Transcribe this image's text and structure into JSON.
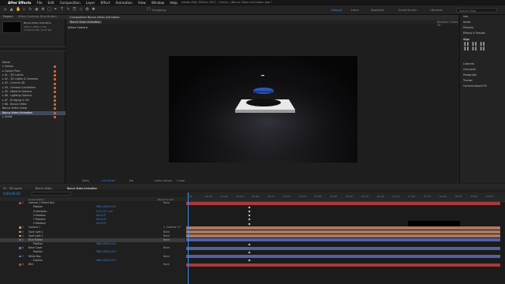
{
  "menubar": {
    "items": [
      "After Effects",
      "File",
      "Edit",
      "Composition",
      "Layer",
      "Effect",
      "Animation",
      "View",
      "Window",
      "Help"
    ],
    "title": "Adobe After Effects 2020 - /Users/.../Bonus Video Animation.aep *"
  },
  "toolbar": {
    "snapping": "Snapping",
    "workspaces": [
      "Default",
      "Learn",
      "Standard",
      "Small Screen",
      "Libraries"
    ],
    "search": "Search Help"
  },
  "project": {
    "tab": "Project",
    "effects_tab": "Effect Controls: Blue Button",
    "selected_name": "Bonus Video Animation",
    "selected_info": [
      "1920 x 1080 (1.00)",
      "Δ 0;00;10;00, 29.97 fps"
    ],
    "items": [
      {
        "label": "Name",
        "sel": false
      },
      {
        "label": "▾ Comps",
        "sel": false
      },
      {
        "label": "  ▸ Comps Prep",
        "sel": false
      },
      {
        "label": "  ▸ 01 - 3D Layers",
        "sel": false
      },
      {
        "label": "  ▸ 02 - 3D Lights & Cameras",
        "sel": false
      },
      {
        "label": "  ▸ 03 - Cinema 4D",
        "sel": false
      },
      {
        "label": "  ▸ 04 - Camera Controllers",
        "sel": false
      },
      {
        "label": "  ▸ 05 - Material Options",
        "sel": false
      },
      {
        "label": "  ▸ 06 - Lighting Options",
        "sel": false
      },
      {
        "label": "  ▸ 07 - Bridging in 3D",
        "sel": false
      },
      {
        "label": "  ▾ 08 - Bonus Video",
        "sel": false
      },
      {
        "label": "      Bonus Video Comp",
        "sel": false
      },
      {
        "label": "      Bonus Video Animation",
        "sel": true
      },
      {
        "label": "▸ Solids",
        "sel": false
      }
    ]
  },
  "viewer": {
    "tab": "Composition Bonus Video Animation",
    "sub_tab": "Bonus Video Animation",
    "camera_label": "Active Camera",
    "renderer": "Renderer: Classic 3D",
    "footer": {
      "zoom": "(50%)",
      "time": "0;00;00;00",
      "resolution": "Full",
      "view": "Active Camera",
      "views": "1 View"
    }
  },
  "right_panel": {
    "items": [
      "Info",
      "Audio",
      "Preview",
      "Effects & Presets",
      "Align",
      "Libraries",
      "Character",
      "Paragraph",
      "Tracker",
      "Content-Aware Fill"
    ]
  },
  "timeline": {
    "tabs": [
      "01 - 3D Layers",
      "Bonus Video",
      "Bonus Video Animation"
    ],
    "time": "0;00;00;00",
    "header": {
      "source": "Source Name",
      "mode": "Parent & Link"
    },
    "ruler_ticks": [
      "0f",
      "00:15f",
      "01:00f",
      "01:15f",
      "02:00f",
      "02:15f",
      "03:00f",
      "03:15f",
      "04:00f",
      "04:15f",
      "05:00f",
      "05:15f",
      "06:00f",
      "06:15f",
      "07:00f",
      "07:15f",
      "08:00f",
      "08:15f",
      "09:00f",
      "09:15f"
    ],
    "layers": [
      {
        "num": "1",
        "name": "Camera 1 Parent Null",
        "value": "",
        "mode": "None",
        "color": "#c04040",
        "sel": false
      },
      {
        "num": "",
        "name": "Position",
        "value": "960.0,540.0,0.0",
        "mode": "",
        "color": "#1f1f1f",
        "sel": false
      },
      {
        "num": "",
        "name": "Orientation",
        "value": "0.0°,0.0°,0.0°",
        "mode": "",
        "color": "#1f1f1f",
        "sel": false
      },
      {
        "num": "",
        "name": "X Rotation",
        "value": "0x+0.0°",
        "mode": "",
        "color": "#1f1f1f",
        "sel": false
      },
      {
        "num": "",
        "name": "Y Rotation",
        "value": "0x+0.0°",
        "mode": "",
        "color": "#1f1f1f",
        "sel": false
      },
      {
        "num": "",
        "name": "Z Rotation",
        "value": "0x+0.0°",
        "mode": "",
        "color": "#1f1f1f",
        "sel": false
      },
      {
        "num": "2",
        "name": "Camera 1",
        "value": "",
        "mode": "1. Camera 1 P",
        "color": "#c48a6a",
        "sel": false
      },
      {
        "num": "3",
        "name": "Spot Light 1",
        "value": "",
        "mode": "None",
        "color": "#c48a6a",
        "sel": false
      },
      {
        "num": "4",
        "name": "Spot Light 2",
        "value": "",
        "mode": "None",
        "color": "#c48a6a",
        "sel": false
      },
      {
        "num": "5",
        "name": "Blue Button",
        "value": "",
        "mode": "None",
        "color": "#5b6fb8",
        "sel": true
      },
      {
        "num": "",
        "name": "Position",
        "value": "960.0,540.0,0.0",
        "mode": "",
        "color": "#1f1f1f",
        "sel": false
      },
      {
        "num": "6",
        "name": "Base Cover",
        "value": "",
        "mode": "None",
        "color": "#5b6fb8",
        "sel": false
      },
      {
        "num": "",
        "name": "Position",
        "value": "960.0,540.0,0.0",
        "mode": "",
        "color": "#1f1f1f",
        "sel": false
      },
      {
        "num": "7",
        "name": "White Box",
        "value": "",
        "mode": "None",
        "color": "#5b6fb8",
        "sel": false
      },
      {
        "num": "",
        "name": "Position",
        "value": "960.0,540.0,0.0",
        "mode": "",
        "color": "#1f1f1f",
        "sel": false
      },
      {
        "num": "8",
        "name": "BKG",
        "value": "",
        "mode": "None",
        "color": "#c04040",
        "sel": false
      }
    ]
  },
  "colors": {
    "accent": "#3b8eea",
    "label_orange": "#c7642b",
    "bar_red": "#a04646",
    "bar_tan": "#a08070",
    "bar_blue": "#4a5f9e"
  }
}
